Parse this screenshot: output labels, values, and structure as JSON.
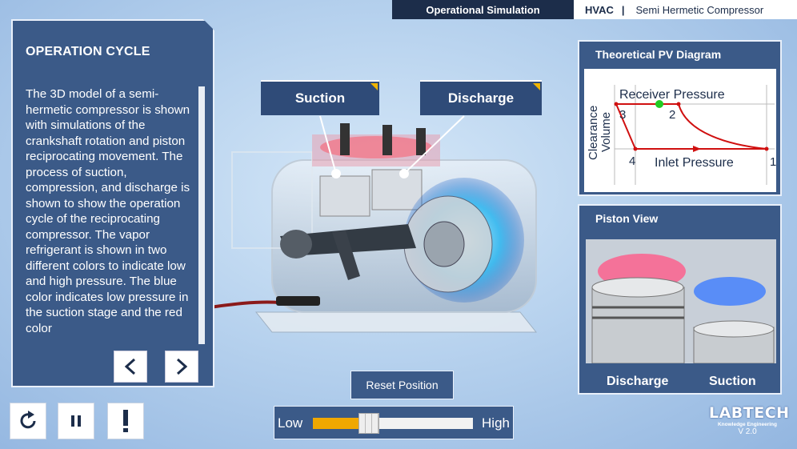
{
  "header": {
    "mode": "Operational Simulation",
    "section": "HVAC",
    "separator": "|",
    "title": "Semi Hermetic Compressor"
  },
  "left_panel": {
    "title": "OPERATION CYCLE",
    "body": "The 3D model of a semi-hermetic compressor is shown with simulations of the crankshaft rotation and piston reciprocating movement. The process of suction, compression, and discharge is shown to show the operation cycle of the reciprocating compressor. The vapor refrigerant is shown in two different colors to indicate low and high pressure. The blue color indicates low pressure in the suction stage and the red color",
    "prev_icon": "chevron-left-icon",
    "next_icon": "chevron-right-icon"
  },
  "labels": {
    "suction": "Suction",
    "discharge": "Discharge"
  },
  "pv_panel": {
    "title": "Theoretical PV Diagram",
    "top_label": "Receiver Pressure",
    "bottom_label": "Inlet Pressure",
    "y_label_1": "Clearance",
    "y_label_2": "Volume",
    "points": [
      "1",
      "2",
      "3",
      "4"
    ],
    "curve_color": "#d01010",
    "marker_color": "#22cc22"
  },
  "piston_panel": {
    "title": "Piston View",
    "left_label": "Discharge",
    "right_label": "Suction"
  },
  "controls": {
    "restart_icon": "restart-icon",
    "pause_icon": "pause-icon",
    "info_icon": "exclamation-icon",
    "reset_label": "Reset Position",
    "speed_low": "Low",
    "speed_high": "High",
    "speed_value": 0.35,
    "accent": "#f0a800"
  },
  "brand": {
    "logo": "LABTECH",
    "tagline": "Knowledge Engineering",
    "version": "V 2.0"
  }
}
